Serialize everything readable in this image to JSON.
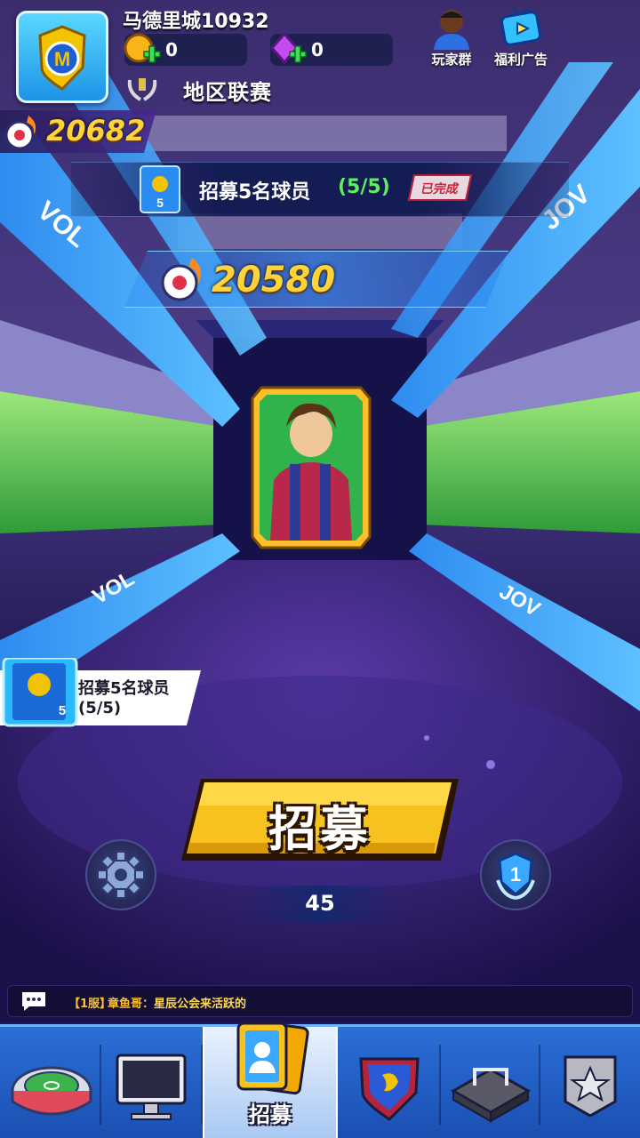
{
  "header": {
    "club_name": "马德里城10932",
    "gold": "0",
    "gems": "0",
    "league": "地区联赛",
    "players_group_label": "玩家群",
    "ads_label": "福利广告",
    "power": "20682"
  },
  "task": {
    "text": "招募5名球员",
    "progress": "(5/5)",
    "status": "已完成",
    "card_count": "5"
  },
  "stadium": {
    "power": "20580",
    "banner_text": "VOL"
  },
  "side_task": {
    "line1": "招募5名球员",
    "line2": "(5/5)",
    "card_count": "5"
  },
  "recruit": {
    "button_label": "招募",
    "cost": "45",
    "level": "1"
  },
  "chat": {
    "server": "【1服】",
    "user": "章鱼哥：",
    "message": "星辰公会来活跃的"
  },
  "bottom_nav": {
    "active_label": "招募",
    "items": [
      "stadium",
      "computer",
      "recruit",
      "club",
      "pitch",
      "rank"
    ]
  },
  "colors": {
    "gold_text": "#ffd43a",
    "progress_green": "#5df05a",
    "done_red": "#d1203a",
    "recruit_button": "#f7c21d",
    "nav_blue": "#2a6fd6"
  }
}
